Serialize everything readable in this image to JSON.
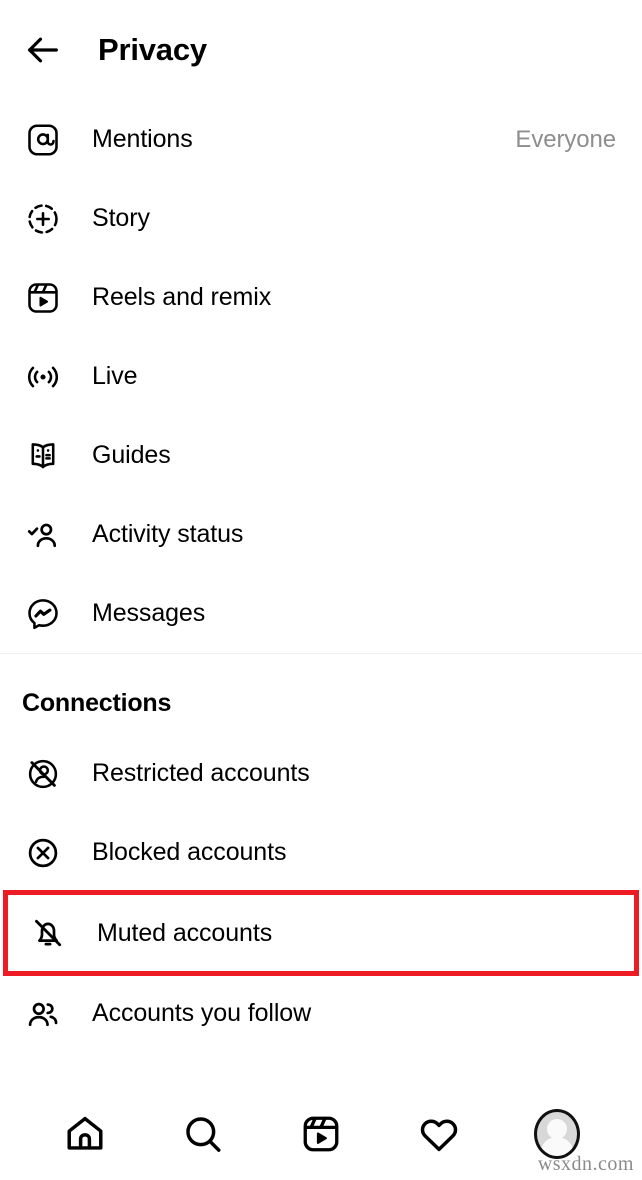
{
  "header": {
    "title": "Privacy",
    "back_icon": "arrow-left-icon"
  },
  "sections": [
    {
      "id": "interactions",
      "title": "",
      "items": [
        {
          "label": "Mentions",
          "value": "Everyone",
          "icon": "at-mention-icon"
        },
        {
          "label": "Story",
          "value": "",
          "icon": "story-add-icon"
        },
        {
          "label": "Reels and remix",
          "value": "",
          "icon": "reels-icon"
        },
        {
          "label": "Live",
          "value": "",
          "icon": "live-broadcast-icon"
        },
        {
          "label": "Guides",
          "value": "",
          "icon": "guides-book-icon"
        },
        {
          "label": "Activity status",
          "value": "",
          "icon": "activity-status-icon"
        },
        {
          "label": "Messages",
          "value": "",
          "icon": "messenger-icon"
        }
      ]
    },
    {
      "id": "connections",
      "title": "Connections",
      "items": [
        {
          "label": "Restricted accounts",
          "value": "",
          "icon": "restricted-account-icon"
        },
        {
          "label": "Blocked accounts",
          "value": "",
          "icon": "blocked-account-icon"
        },
        {
          "label": "Muted accounts",
          "value": "",
          "icon": "bell-off-icon",
          "highlighted": true
        },
        {
          "label": "Accounts you follow",
          "value": "",
          "icon": "people-icon"
        }
      ]
    }
  ],
  "highlight": {
    "color": "#ed1c24",
    "target": "Muted accounts"
  },
  "bottom_nav": [
    {
      "icon": "home-icon",
      "label": "Home"
    },
    {
      "icon": "search-icon",
      "label": "Search"
    },
    {
      "icon": "reels-icon",
      "label": "Reels"
    },
    {
      "icon": "heart-icon",
      "label": "Activity"
    },
    {
      "icon": "profile-avatar-icon",
      "label": "Profile"
    }
  ],
  "watermark": "wsxdn.com",
  "colors": {
    "text": "#000000",
    "muted_text": "#8e8e8e",
    "divider": "#efefef",
    "highlight": "#ed1c24"
  }
}
